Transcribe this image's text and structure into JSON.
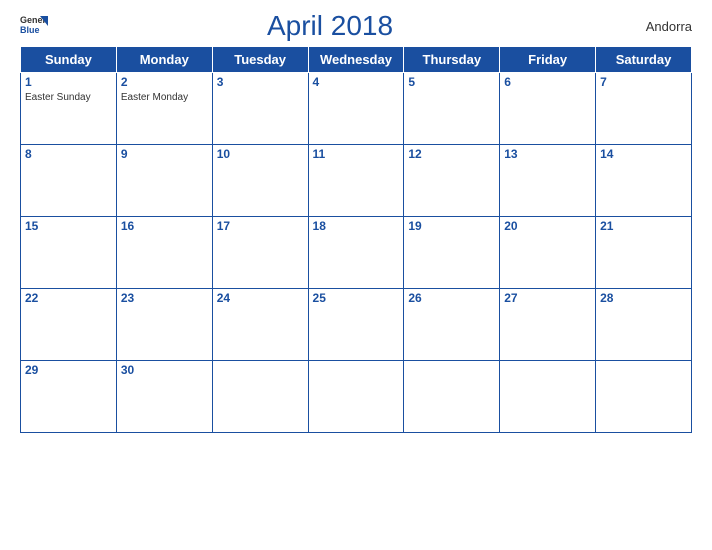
{
  "header": {
    "logo_general": "General",
    "logo_blue": "Blue",
    "title": "April 2018",
    "country": "Andorra"
  },
  "days_of_week": [
    "Sunday",
    "Monday",
    "Tuesday",
    "Wednesday",
    "Thursday",
    "Friday",
    "Saturday"
  ],
  "weeks": [
    [
      {
        "date": "1",
        "holiday": "Easter Sunday"
      },
      {
        "date": "2",
        "holiday": "Easter Monday"
      },
      {
        "date": "3",
        "holiday": ""
      },
      {
        "date": "4",
        "holiday": ""
      },
      {
        "date": "5",
        "holiday": ""
      },
      {
        "date": "6",
        "holiday": ""
      },
      {
        "date": "7",
        "holiday": ""
      }
    ],
    [
      {
        "date": "8",
        "holiday": ""
      },
      {
        "date": "9",
        "holiday": ""
      },
      {
        "date": "10",
        "holiday": ""
      },
      {
        "date": "11",
        "holiday": ""
      },
      {
        "date": "12",
        "holiday": ""
      },
      {
        "date": "13",
        "holiday": ""
      },
      {
        "date": "14",
        "holiday": ""
      }
    ],
    [
      {
        "date": "15",
        "holiday": ""
      },
      {
        "date": "16",
        "holiday": ""
      },
      {
        "date": "17",
        "holiday": ""
      },
      {
        "date": "18",
        "holiday": ""
      },
      {
        "date": "19",
        "holiday": ""
      },
      {
        "date": "20",
        "holiday": ""
      },
      {
        "date": "21",
        "holiday": ""
      }
    ],
    [
      {
        "date": "22",
        "holiday": ""
      },
      {
        "date": "23",
        "holiday": ""
      },
      {
        "date": "24",
        "holiday": ""
      },
      {
        "date": "25",
        "holiday": ""
      },
      {
        "date": "26",
        "holiday": ""
      },
      {
        "date": "27",
        "holiday": ""
      },
      {
        "date": "28",
        "holiday": ""
      }
    ],
    [
      {
        "date": "29",
        "holiday": ""
      },
      {
        "date": "30",
        "holiday": ""
      },
      {
        "date": "",
        "holiday": ""
      },
      {
        "date": "",
        "holiday": ""
      },
      {
        "date": "",
        "holiday": ""
      },
      {
        "date": "",
        "holiday": ""
      },
      {
        "date": "",
        "holiday": ""
      }
    ]
  ]
}
